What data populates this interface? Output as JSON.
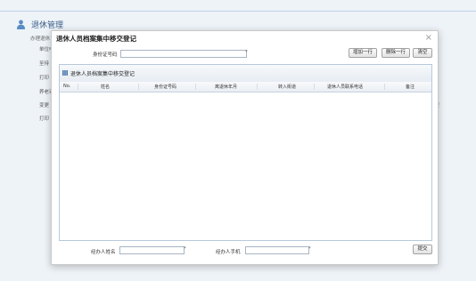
{
  "background": {
    "section_title": "退休管理",
    "subtitle": "办理退休",
    "menu_items": [
      "单位申",
      "至待",
      "打印",
      "养老审",
      "变更",
      "打印"
    ]
  },
  "dialog": {
    "title": "退休人员档案集中移交登记",
    "close_icon": "×",
    "id_label": "身份证号码",
    "id_value": "",
    "required_mark": "*",
    "buttons": {
      "add_row": "增加一行",
      "delete_row": "删除一行",
      "clear": "清空"
    },
    "panel": {
      "title": "退休人员档案集中移交登记",
      "columns": [
        "No.",
        "姓名",
        "身份证号码",
        "离退休年月",
        "转入街道",
        "退休人员联系电话",
        "备注"
      ],
      "rows": []
    },
    "footer": {
      "handler_name_label": "经办人姓名",
      "handler_name_value": "",
      "handler_phone_label": "经办人手机",
      "handler_phone_value": "",
      "submit": "提交"
    }
  },
  "colors": {
    "accent": "#3a5e88",
    "panel_border": "#b7c9dc"
  }
}
